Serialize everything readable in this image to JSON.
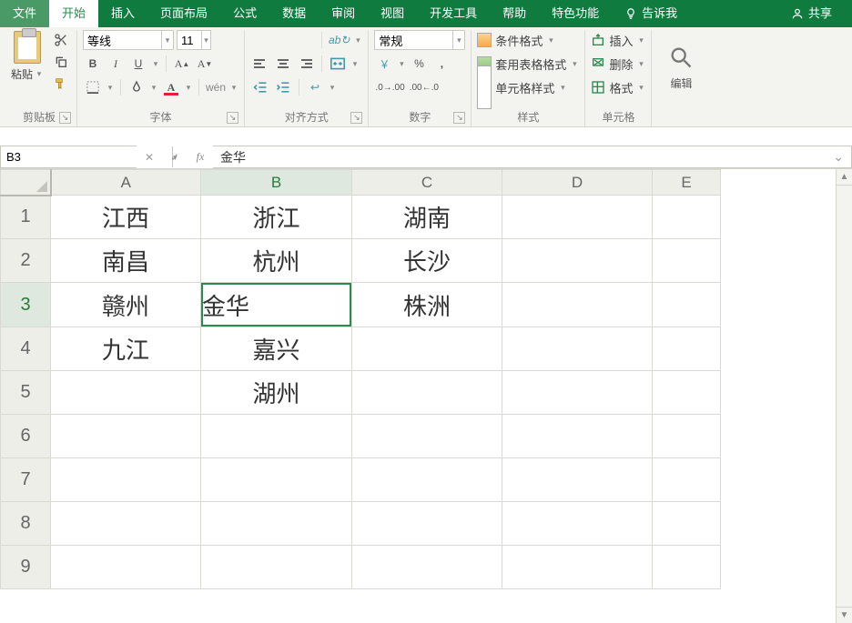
{
  "tabs": {
    "file": "文件",
    "home": "开始",
    "insert": "插入",
    "layout": "页面布局",
    "formulas": "公式",
    "data": "数据",
    "review": "审阅",
    "view": "视图",
    "devtools": "开发工具",
    "help": "帮助",
    "special": "特色功能",
    "tellme": "告诉我",
    "share": "共享"
  },
  "clipboard": {
    "paste": "粘贴",
    "label": "剪贴板"
  },
  "font": {
    "name": "等线",
    "size": "11",
    "bold": "B",
    "italic": "I",
    "underline": "U",
    "label": "字体"
  },
  "align": {
    "wrap": "ab",
    "merge": "合",
    "label": "对齐方式"
  },
  "number": {
    "format": "常规",
    "pct": "%",
    "comma": ",",
    "label": "数字"
  },
  "styles": {
    "cond": "条件格式",
    "table": "套用表格格式",
    "cell": "单元格样式",
    "label": "样式"
  },
  "cells": {
    "insert": "插入",
    "delete": "删除",
    "format": "格式",
    "label": "单元格"
  },
  "editing": {
    "label": "编辑"
  },
  "formula_bar": {
    "ref": "B3",
    "value": "金华"
  },
  "grid": {
    "cols": [
      "A",
      "B",
      "C",
      "D",
      "E"
    ],
    "rows": [
      "1",
      "2",
      "3",
      "4",
      "5",
      "6",
      "7",
      "8",
      "9"
    ],
    "data": [
      [
        "江西",
        "浙江",
        "湖南",
        "",
        ""
      ],
      [
        "南昌",
        "杭州",
        "长沙",
        "",
        ""
      ],
      [
        "赣州",
        "金华",
        "株洲",
        "",
        ""
      ],
      [
        "九江",
        "嘉兴",
        "",
        "",
        ""
      ],
      [
        "",
        "湖州",
        "",
        "",
        ""
      ],
      [
        "",
        "",
        "",
        "",
        ""
      ],
      [
        "",
        "",
        "",
        "",
        ""
      ],
      [
        "",
        "",
        "",
        "",
        ""
      ],
      [
        "",
        "",
        "",
        "",
        ""
      ]
    ],
    "selected": {
      "row": 3,
      "col": 2
    }
  }
}
